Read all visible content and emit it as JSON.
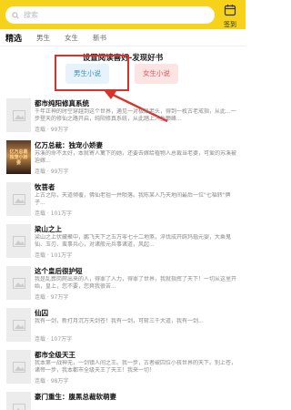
{
  "header": {
    "search_placeholder": "搜索",
    "signin_label": "签到"
  },
  "tabs": [
    {
      "label": "精选"
    },
    {
      "label": "男生"
    },
    {
      "label": "女生"
    },
    {
      "label": "新书"
    }
  ],
  "preference": {
    "title": "设置阅读喜好-发现好书",
    "male_label": "男生小说",
    "female_label": "女生小说"
  },
  "books": [
    {
      "title": "都市纯阳修真系统",
      "desc": "千年正神的时空穿越到这个世界，遇见一对极品老头，得到一枚古老戒指，从此...一步登天的修仙之路开启，纯阳修真系统，从此踏上人生巅峰...",
      "meta": "连载 · 99万字",
      "cover_text": ""
    },
    {
      "title": "亿万总裁：独宠小娇妻",
      "desc": "苏溪的命不太好，本就寄人篱下的她，还要去嫁给植物人总裁当老婆，可爱的苏溪被迫嫁...",
      "meta": "连载 · 99万字",
      "cover_text": "亿万总裁 独宠小娇妻"
    },
    {
      "title": "牧菩者",
      "desc": "上古之际，天道倾覆，佛仙老祖一并陨落。我陈某人乃天地间最后一位\"七福转\"牌子...",
      "meta": "连载 · 101万字",
      "cover_text": ""
    },
    {
      "title": "梁山之上",
      "desc": "梁山之上伏藏聚中，鹏飞天下之五万零七十二地煞，淬伐成开辟玛瑙元婴，大乘鬼仙、玉刃、蛮事兵心，对诸般元兵事诸道，风起...",
      "meta": "连载 · 101万字",
      "cover_text": ""
    },
    {
      "title": "这个皇后很护短",
      "desc": "我是乱葬岗爬出来的人，得罪了人力，得罪了世界，我就指挥了天下！一切从这里开始，皇上，您不要，您爽我很苦...",
      "meta": "连载 · 97万字",
      "cover_text": ""
    },
    {
      "title": "仙囚",
      "desc": "我有一剑，新打月沉万天剑苍！我有一剑，可斩三千大道，我有一剑...",
      "meta": "连载 · 107万字",
      "cover_text": ""
    },
    {
      "title": "都市全级天王",
      "desc": "我本第一战神无，一剑镇人间之王。我一步，古者破囚位小孩世界的天下。别上苍，诸帝一步，我本都市全级天王了天王！我来一切！",
      "meta": "连载 · 98万字",
      "cover_text": ""
    },
    {
      "title": "豪门重生：腹黑总裁软萌妻",
      "desc": "",
      "meta": "",
      "cover_text": ""
    }
  ]
}
